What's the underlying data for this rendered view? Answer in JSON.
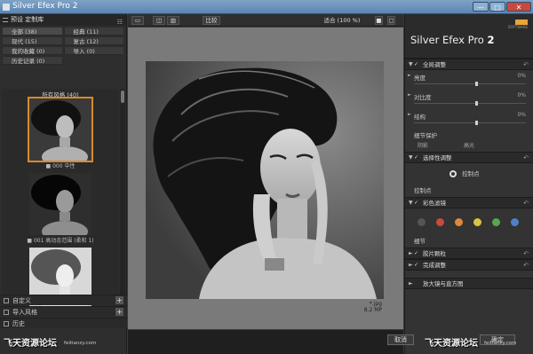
{
  "window": {
    "title": "Silver Efex Pro 2",
    "min_label": "—",
    "max_label": "□",
    "close_label": "✕"
  },
  "left_panel": {
    "header": "预设 定制库",
    "grid_glyph": "☷",
    "categories": [
      {
        "label": "全部 (38)",
        "active": true
      },
      {
        "label": "经典 (11)"
      },
      {
        "label": "现代 (15)"
      },
      {
        "label": "复古 (12)"
      },
      {
        "label": "我的收藏 (0)"
      },
      {
        "label": "导入 (0)"
      },
      {
        "label": "历史记录 (0)"
      }
    ],
    "filmstrip_label": "所有风格 (40)",
    "thumbnails": [
      {
        "caption": "■ 000 中性"
      },
      {
        "caption": "■ 001 高动态范围 (柔和 1)"
      },
      {
        "caption": ""
      }
    ],
    "footer": [
      {
        "label": "自定义"
      },
      {
        "label": "导入风格"
      },
      {
        "label": "历史"
      }
    ]
  },
  "toolbar": {
    "compare_label": "比较",
    "zoom_label": "适合 (100 %)"
  },
  "canvas": {
    "file_name": "*.jpg",
    "file_size": "8.2 MP"
  },
  "right_panel": {
    "product_name": "Silver Efex Pro",
    "product_version": "2",
    "brand": "Nik",
    "brand_sub": "SOFTWARE",
    "sections": {
      "global": "全局调整",
      "selective": "选择性调整",
      "color_filter": "彩色滤镜",
      "film": "胶片颗粒",
      "finishing": "完成调整",
      "loupe": "放大镜与直方图"
    },
    "sliders": [
      {
        "label": "亮度",
        "value": "0%",
        "level": 0.55
      },
      {
        "label": "对比度",
        "value": "0%",
        "level": 0.55
      },
      {
        "label": "结构",
        "value": "0%",
        "level": 0.55
      }
    ],
    "protection_label": "细节保护",
    "protect_shadows": "阴影",
    "protect_highlights": "高光",
    "control_point_label": "控制点",
    "control_point_sub": "控制点",
    "filter_colors": [
      "#555555",
      "#c94a3b",
      "#e0873a",
      "#d8c443",
      "#5aa64f",
      "#4f7fc8"
    ],
    "filter_label": "细节"
  },
  "bottom": {
    "cancel_label": "取消",
    "ok_label": "确定"
  },
  "watermarks": [
    {
      "text": "飞天资源论坛",
      "url": "feitianzy.com"
    },
    {
      "text": "飞天资源论坛",
      "url": "feitianzy.com"
    }
  ]
}
